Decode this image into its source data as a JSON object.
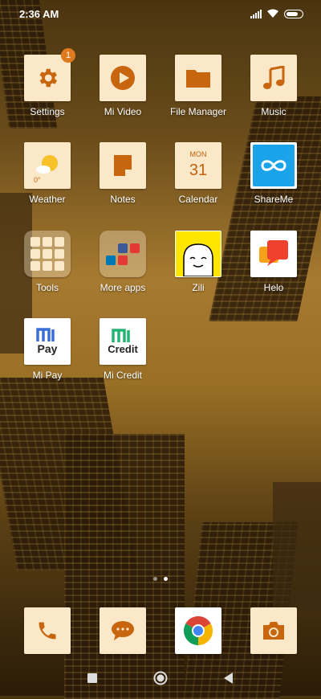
{
  "status": {
    "time": "2:36 AM"
  },
  "apps": {
    "settings": {
      "label": "Settings",
      "badge": "1"
    },
    "mi_video": {
      "label": "Mi Video"
    },
    "file_manager": {
      "label": "File Manager"
    },
    "music": {
      "label": "Music"
    },
    "weather": {
      "label": "Weather",
      "temp": "0°"
    },
    "notes": {
      "label": "Notes"
    },
    "calendar": {
      "label": "Calendar",
      "month": "MON",
      "day": "31"
    },
    "shareme": {
      "label": "ShareMe"
    },
    "tools": {
      "label": "Tools"
    },
    "more_apps": {
      "label": "More apps"
    },
    "zili": {
      "label": "Zili"
    },
    "helo": {
      "label": "Helo"
    },
    "mi_pay": {
      "label": "Mi Pay",
      "logo_text": "Pay"
    },
    "mi_credit": {
      "label": "Mi Credit",
      "logo_text": "Credit"
    }
  },
  "colors": {
    "accent": "#c8650f",
    "tile": "#fbe8c8"
  }
}
